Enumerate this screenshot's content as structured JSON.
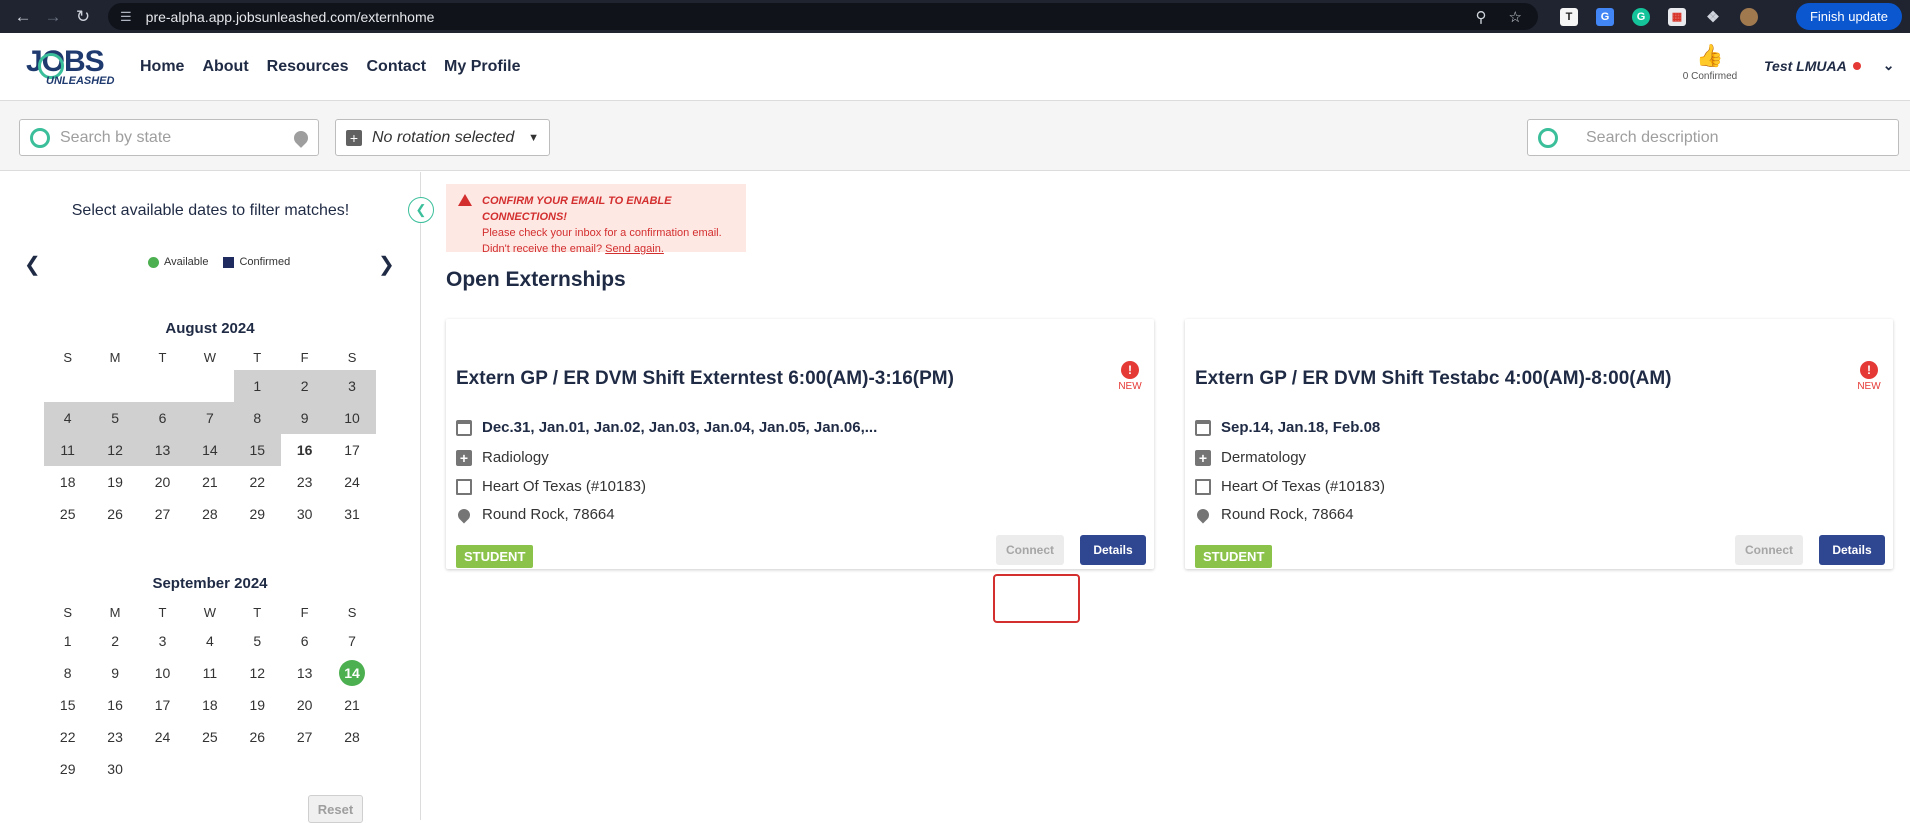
{
  "browser": {
    "url": "pre-alpha.app.jobsunleashed.com/externhome",
    "finish_label": "Finish update"
  },
  "header": {
    "logo_big": "JOBS",
    "logo_small": "UNLEASHED",
    "nav": [
      "Home",
      "About",
      "Resources",
      "Contact",
      "My Profile"
    ],
    "confirmed_count": "0 Confirmed",
    "user_name": "Test LMUAA"
  },
  "filters": {
    "state_placeholder": "Search by state",
    "rotation_label": "No rotation selected",
    "description_placeholder": "Search description"
  },
  "sidebar": {
    "title": "Select available dates to filter matches!",
    "legend_available": "Available",
    "legend_confirmed": "Confirmed",
    "weekdays": [
      "S",
      "M",
      "T",
      "W",
      "T",
      "F",
      "S"
    ],
    "months": [
      {
        "title": "August 2024",
        "offset": 4,
        "days": 31,
        "past_until": 15,
        "today": 16,
        "available": []
      },
      {
        "title": "September 2024",
        "offset": 0,
        "days": 30,
        "past_until": 0,
        "today": 0,
        "available": [
          14
        ]
      }
    ],
    "reset_label": "Reset"
  },
  "alert": {
    "title": "CONFIRM YOUR EMAIL TO ENABLE CONNECTIONS!",
    "line1": "Please check your inbox for a confirmation email.",
    "line2": "Didn't receive the email?",
    "link": "Send again."
  },
  "section_title": "Open Externships",
  "cards": [
    {
      "title": "Extern GP / ER DVM Shift Externtest 6:00(AM)-3:16(PM)",
      "new_label": "NEW",
      "dates": "Dec.31, Jan.01, Jan.02, Jan.03, Jan.04, Jan.05, Jan.06,...",
      "specialty": "Radiology",
      "clinic": "Heart Of Texas (#10183)",
      "location": "Round Rock, 78664",
      "tag": "STUDENT",
      "connect_label": "Connect",
      "details_label": "Details"
    },
    {
      "title": "Extern GP / ER DVM Shift Testabc 4:00(AM)-8:00(AM)",
      "new_label": "NEW",
      "dates": "Sep.14, Jan.18, Feb.08",
      "specialty": "Dermatology",
      "clinic": "Heart Of Texas (#10183)",
      "location": "Round Rock, 78664",
      "tag": "STUDENT",
      "connect_label": "Connect",
      "details_label": "Details"
    }
  ]
}
